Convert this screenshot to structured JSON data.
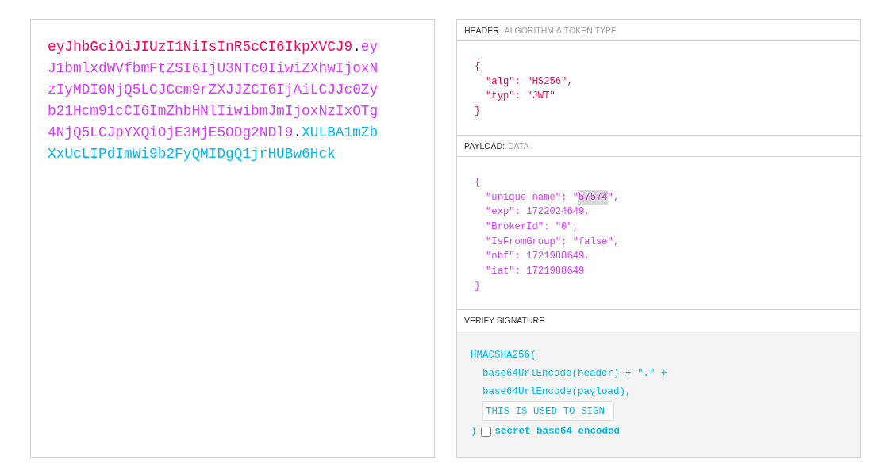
{
  "encoded": {
    "parts": [
      {
        "text": "eyJhbGciOiJIUzI1NiIsInR5cCI6IkpXVCJ9",
        "color": "#fb015b",
        "separator": "."
      },
      {
        "text": "eyJ1bmlxdWVfbmFtZSI6IjU3NTc0IiwiZXhwIjoxNzIyMDI0NjQ5LCJCcm9rZXJJZCI6IjAiLCJJc0Zyb21Hcm91cCI6ImZhbHNlIiwibmJmIjoxNzIxOTg4NjQ5LCJpYXQiOjE3MjE5ODg2NDl9",
        "color": "#d63aff",
        "separator": "."
      },
      {
        "text": "XULBA1mZbXxUcLIPdImWi9b2FyQMIDgQ1jrHUBw6Hck",
        "color": "#00b9f1"
      }
    ]
  },
  "header": {
    "title": "HEADER:",
    "subtitle": "ALGORITHM & TOKEN TYPE",
    "open": "{",
    "entries": [
      "\"alg\": \"HS256\",",
      "\"typ\": \"JWT\""
    ],
    "close": "}"
  },
  "payload": {
    "title": "PAYLOAD:",
    "subtitle": "DATA",
    "open": "{",
    "entries": [
      {
        "segments": [
          {
            "text": "\"unique_name\": \"",
            "highlighted": false
          },
          {
            "text": "57574",
            "highlighted": true
          },
          {
            "text": "\",",
            "highlighted": false
          }
        ]
      },
      {
        "segments": [
          {
            "text": "\"exp\": 1722024649,",
            "highlighted": false
          }
        ]
      },
      {
        "segments": [
          {
            "text": "\"BrokerId\": \"0\",",
            "highlighted": false
          }
        ]
      },
      {
        "segments": [
          {
            "text": "\"IsFromGroup\": \"false\",",
            "highlighted": false
          }
        ]
      },
      {
        "segments": [
          {
            "text": "\"nbf\": 1721988649,",
            "highlighted": false
          }
        ]
      },
      {
        "segments": [
          {
            "text": "\"iat\": 1721988649",
            "highlighted": false
          }
        ]
      }
    ],
    "close": "}"
  },
  "verify_signature": {
    "title": "VERIFY SIGNATURE",
    "function": "HMACSHA256(",
    "args": [
      "base64UrlEncode(header) + \".\" +",
      "base64UrlEncode(payload),"
    ],
    "secret": {
      "value": "THIS IS USED TO SIGN"
    },
    "close": ")",
    "base64_checkbox": {
      "label": "secret base64 encoded",
      "checked": false
    }
  }
}
